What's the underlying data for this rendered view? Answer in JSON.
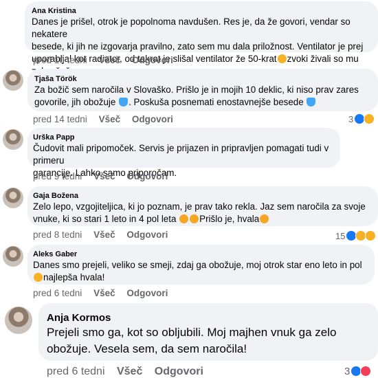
{
  "comments": [
    {
      "author": "Ana Kristina",
      "lines": [
        "Danes je prišel, otrok je popolnoma navdušen. Res je, da že govori, vendar so nekatere",
        "besede, ki jih ne izgovarja pravilno, zato sem mu dala priložnost. Ventilator je prej",
        "uporabljal kot radiator, od takrat je slišal ventilator že 50-krat",
        "zvoki živali so mu zelo všeč."
      ],
      "time": "pred 10 tedni",
      "like": "Všeč",
      "reply": "Odgovori"
    },
    {
      "author": "Tjaša Török",
      "lines": [
        "Za božič sem naročila v Slovaško. Prišlo je in mojih 10 deklic, ki niso prav zares",
        "govorile, jih obožuje",
        ". Poskuša posnemati enostavnejše besede"
      ],
      "time": "pred 14 tedni",
      "like": "Všeč",
      "reply": "Odgovori",
      "reactions": "3"
    },
    {
      "author": "Urška Papp",
      "lines": [
        "Čudovit mali pripomoček. Servis je prijazen in pripravljen pomagati tudi v primeru",
        "garancije. Lahko samo priporočam."
      ],
      "time": "pred 9 tedni",
      "like": "Všeč",
      "reply": "Odgovori"
    },
    {
      "author": "Gaja Božena",
      "lines": [
        "Zelo lepo, vzgojiteljica, ki jo poznam, je prav tako rekla. Jaz sem naročila za svoje",
        "vnuke, ki so stari 1 leto in 4 pol leta",
        "Prišlo je, hvala"
      ],
      "time": "pred 8 tedni",
      "like": "Všeč",
      "reply": "Odgovori",
      "reactions": "15"
    },
    {
      "author": "Aleks Gaber",
      "lines": [
        "Danes smo prejeli, veliko se smeji, zdaj ga obožuje, moj otrok star eno leto in pol",
        "najlepša hvala!"
      ],
      "time": "pred 6 tedni",
      "like": "Všeč",
      "reply": "Odgovori"
    },
    {
      "author": "Anja Kormos",
      "lines": [
        "Prejeli smo ga, kot so obljubili. Moj majhen vnuk ga zelo",
        "obožuje. Vesela sem, da sem naročila!"
      ],
      "time": "pred 6 tedni",
      "like": "Všeč",
      "reply": "Odgovori",
      "reactions": "3"
    }
  ]
}
